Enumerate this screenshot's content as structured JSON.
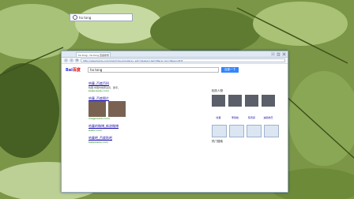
{
  "desktop": {
    "search_text": "ha tong"
  },
  "browser": {
    "tab_label": "ha tong - ha tong 百度搜索",
    "url": "http://www.baidu.com/s?wd=ha+tong&rsv_spt=1&issp=1&f=8&rsv_bp=0&ie=utf-8"
  },
  "page": {
    "logo_text": "Bai",
    "logo_accent": "百度",
    "query": "ha tong",
    "search_button": "百度一下",
    "results": [
      {
        "title": "哈童_百度百科",
        "desc": "哈童,中国内地男演员、歌手。",
        "url": "baike.baidu.com/"
      },
      {
        "title": "哈童_百度图片",
        "desc": "",
        "url": "image.baidu.com/"
      },
      {
        "title": "哈童的微博_新浪微博",
        "desc": "",
        "url": "weibo.com/"
      },
      {
        "title": "哈童吧_百度贴吧",
        "desc": "",
        "url": "tieba.baidu.com/"
      }
    ],
    "sidebar": {
      "heading_people": "相关人物",
      "people": [
        "哈童",
        "李易峰",
        "陈伟霆",
        "迪丽热巴"
      ],
      "heading_rank": "热门搜索"
    }
  }
}
